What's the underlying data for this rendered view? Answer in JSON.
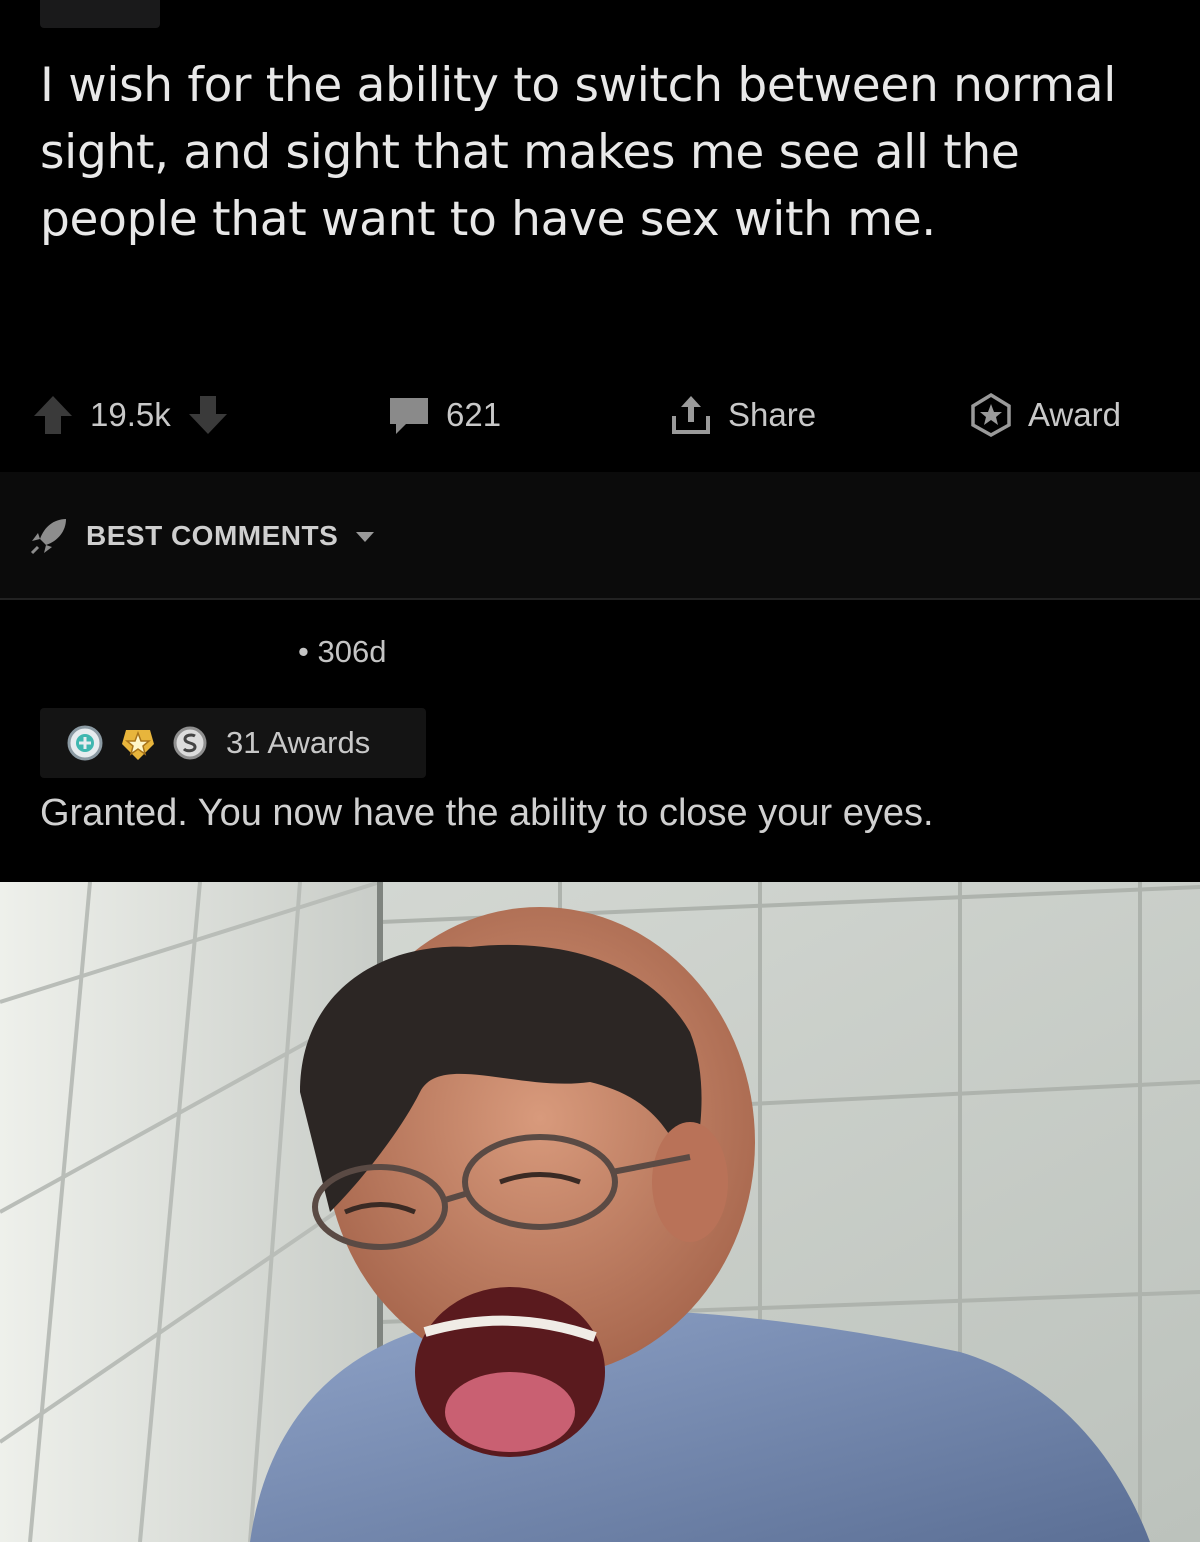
{
  "post": {
    "title": "I wish for the ability to switch between normal sight, and sight that makes me see all the people that want to have sex with me."
  },
  "actions": {
    "score": "19.5k",
    "comments": "621",
    "share": "Share",
    "award": "Award"
  },
  "sort": {
    "label": "BEST COMMENTS"
  },
  "comment": {
    "age": "• 306d",
    "awards_label": "31 Awards",
    "body": "Granted. You now have the ability to close your eyes."
  },
  "icons": {
    "upvote": "upvote-arrow-icon",
    "downvote": "downvote-arrow-icon",
    "comments": "speech-bubble-icon",
    "share": "share-upload-icon",
    "award": "star-badge-icon",
    "sort": "rocket-icon",
    "dropdown": "caret-down-icon"
  },
  "colors": {
    "background": "#000000",
    "text": "#d7dadc",
    "band": "#0b0b0b",
    "pill": "#141414"
  }
}
